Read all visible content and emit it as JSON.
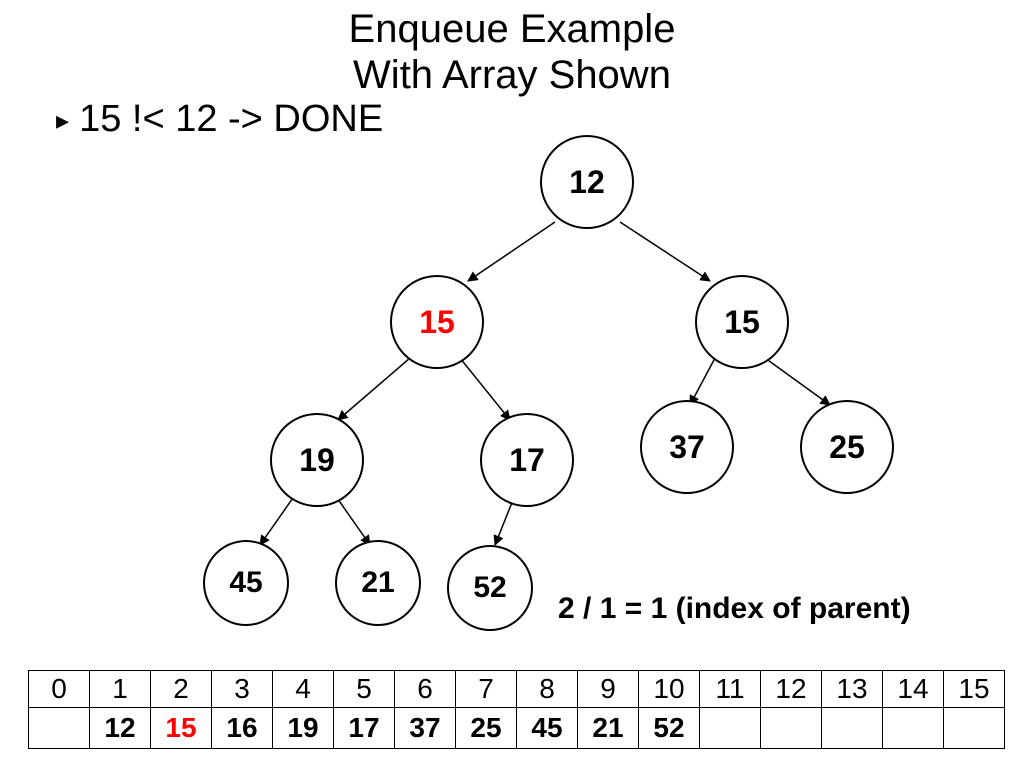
{
  "title_line1": "Enqueue Example",
  "title_line2": "With Array Shown",
  "bullet_text": "15 !< 12 -> DONE",
  "caption_text": "2 / 1 = 1 (index of parent)",
  "nodes": {
    "n1": {
      "label": "12",
      "highlight": false
    },
    "n2": {
      "label": "15",
      "highlight": true
    },
    "n3": {
      "label": "15",
      "highlight": false
    },
    "n4": {
      "label": "19",
      "highlight": false
    },
    "n5": {
      "label": "17",
      "highlight": false
    },
    "n6": {
      "label": "37",
      "highlight": false
    },
    "n7": {
      "label": "25",
      "highlight": false
    },
    "n8": {
      "label": "45",
      "highlight": false
    },
    "n9": {
      "label": "21",
      "highlight": false
    },
    "n10": {
      "label": "52",
      "highlight": false
    }
  },
  "array": {
    "indices": [
      "0",
      "1",
      "2",
      "3",
      "4",
      "5",
      "6",
      "7",
      "8",
      "9",
      "10",
      "11",
      "12",
      "13",
      "14",
      "15"
    ],
    "values": [
      "",
      "12",
      "15",
      "16",
      "19",
      "17",
      "37",
      "25",
      "45",
      "21",
      "52",
      "",
      "",
      "",
      "",
      ""
    ],
    "highlight_cols": [
      2
    ]
  }
}
